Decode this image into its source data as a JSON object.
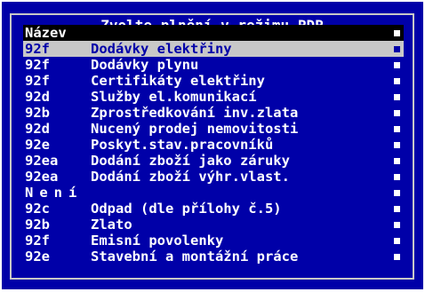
{
  "dialog": {
    "title": "Zvolte plnění v režimu PDP"
  },
  "list": {
    "header": "Název",
    "items": [
      {
        "code": "92f",
        "label": "Dodávky elektřiny",
        "selected": true
      },
      {
        "code": "92f",
        "label": "Dodávky plynu"
      },
      {
        "code": "92f",
        "label": "Certifikáty elektřiny"
      },
      {
        "code": "92d",
        "label": "Služby el.komunikací"
      },
      {
        "code": "92b",
        "label": "Zprostředkování inv.zlata"
      },
      {
        "code": "92d",
        "label": "Nucený prodej nemovitosti"
      },
      {
        "code": "92e",
        "label": "Poskyt.stav.pracovníků"
      },
      {
        "code": "92ea",
        "label": "Dodání zboží jako záruky"
      },
      {
        "code": "92ea",
        "label": "Dodání zboží výhr.vlast."
      },
      {
        "code": "",
        "label": "Není",
        "group": true
      },
      {
        "code": "92c",
        "label": "Odpad (dle přílohy č.5)"
      },
      {
        "code": "92b",
        "label": "Zlato"
      },
      {
        "code": "92f",
        "label": "Emisní povolenky"
      },
      {
        "code": "92e",
        "label": "Stavební a montážní práce"
      }
    ]
  },
  "colors": {
    "background": "#0000a8",
    "text": "#ffffff",
    "selection": "#c8c8c8",
    "header": "#000000"
  }
}
